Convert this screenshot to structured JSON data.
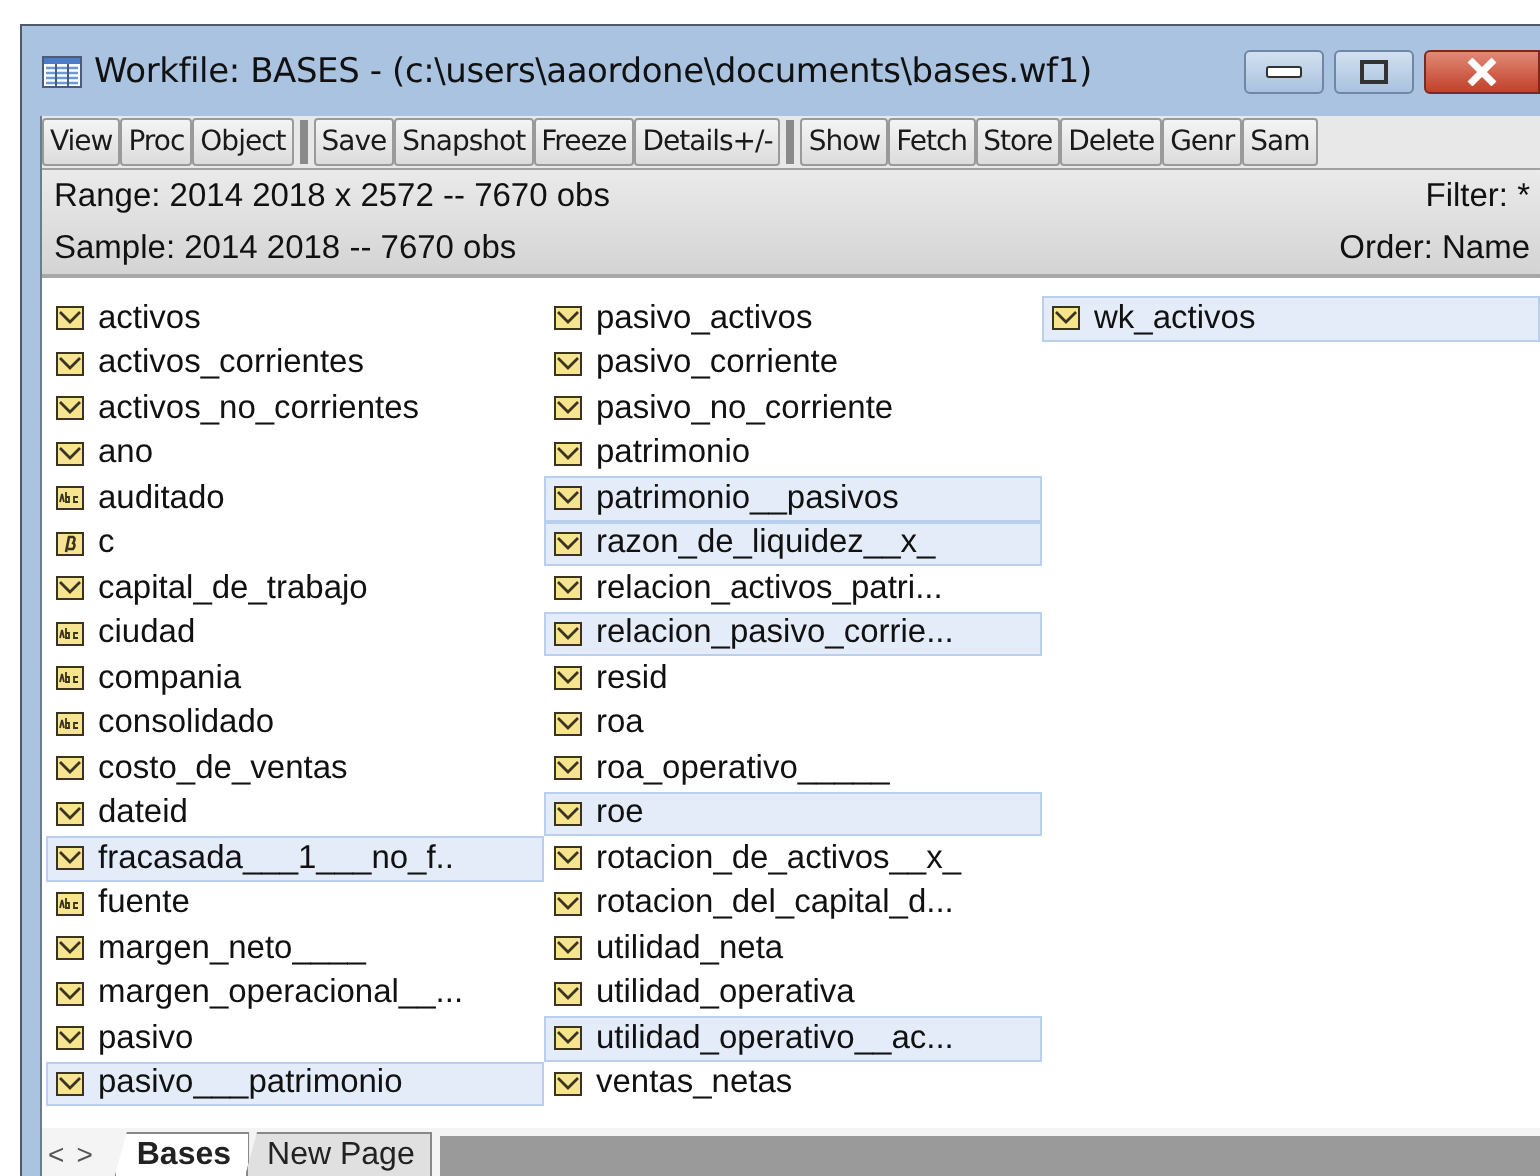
{
  "window": {
    "title": "Workfile: BASES - (c:\\users\\aaordone\\documents\\bases.wf1)"
  },
  "toolbar": [
    {
      "label": "View",
      "group_start": false
    },
    {
      "label": "Proc",
      "group_start": false
    },
    {
      "label": "Object",
      "group_start": false
    },
    {
      "label": "Save",
      "group_start": true
    },
    {
      "label": "Snapshot",
      "group_start": false
    },
    {
      "label": "Freeze",
      "group_start": false
    },
    {
      "label": "Details+/-",
      "group_start": false
    },
    {
      "label": "Show",
      "group_start": true
    },
    {
      "label": "Fetch",
      "group_start": false
    },
    {
      "label": "Store",
      "group_start": false
    },
    {
      "label": "Delete",
      "group_start": false
    },
    {
      "label": "Genr",
      "group_start": false
    },
    {
      "label": "Sam",
      "group_start": false
    }
  ],
  "info": {
    "range": "Range:  2014 2018 x 2572   --   7670 obs",
    "filter": "Filter: *",
    "sample": "Sample: 2014 2018   --   7670 obs",
    "order": "Order: Name"
  },
  "columns": [
    [
      {
        "name": "activos",
        "kind": "series",
        "selected": false
      },
      {
        "name": "activos_corrientes",
        "kind": "series",
        "selected": false
      },
      {
        "name": "activos_no_corrientes",
        "kind": "series",
        "selected": false
      },
      {
        "name": "ano",
        "kind": "series",
        "selected": false
      },
      {
        "name": "auditado",
        "kind": "alpha",
        "selected": false
      },
      {
        "name": "c",
        "kind": "coef",
        "selected": false
      },
      {
        "name": "capital_de_trabajo",
        "kind": "series",
        "selected": false
      },
      {
        "name": "ciudad",
        "kind": "alpha",
        "selected": false
      },
      {
        "name": "compania",
        "kind": "alpha",
        "selected": false
      },
      {
        "name": "consolidado",
        "kind": "alpha",
        "selected": false
      },
      {
        "name": "costo_de_ventas",
        "kind": "series",
        "selected": false
      },
      {
        "name": "dateid",
        "kind": "series",
        "selected": false
      },
      {
        "name": "fracasada___1___no_f..",
        "kind": "series",
        "selected": true
      },
      {
        "name": "fuente",
        "kind": "alpha",
        "selected": false
      },
      {
        "name": "margen_neto____",
        "kind": "series",
        "selected": false
      },
      {
        "name": "margen_operacional__...",
        "kind": "series",
        "selected": false
      },
      {
        "name": "pasivo",
        "kind": "series",
        "selected": false
      },
      {
        "name": "pasivo___patrimonio",
        "kind": "series",
        "selected": true
      }
    ],
    [
      {
        "name": "pasivo_activos",
        "kind": "series",
        "selected": false
      },
      {
        "name": "pasivo_corriente",
        "kind": "series",
        "selected": false
      },
      {
        "name": "pasivo_no_corriente",
        "kind": "series",
        "selected": false
      },
      {
        "name": "patrimonio",
        "kind": "series",
        "selected": false
      },
      {
        "name": "patrimonio__pasivos",
        "kind": "series",
        "selected": true
      },
      {
        "name": "razon_de_liquidez__x_",
        "kind": "series",
        "selected": true
      },
      {
        "name": "relacion_activos_patri...",
        "kind": "series",
        "selected": false
      },
      {
        "name": "relacion_pasivo_corrie...",
        "kind": "series",
        "selected": true
      },
      {
        "name": "resid",
        "kind": "series",
        "selected": false
      },
      {
        "name": "roa",
        "kind": "series",
        "selected": false
      },
      {
        "name": "roa_operativo_____",
        "kind": "series",
        "selected": false
      },
      {
        "name": "roe",
        "kind": "series",
        "selected": true
      },
      {
        "name": "rotacion_de_activos__x_",
        "kind": "series",
        "selected": false
      },
      {
        "name": "rotacion_del_capital_d...",
        "kind": "series",
        "selected": false
      },
      {
        "name": "utilidad_neta",
        "kind": "series",
        "selected": false
      },
      {
        "name": "utilidad_operativa",
        "kind": "series",
        "selected": false
      },
      {
        "name": "utilidad_operativo__ac...",
        "kind": "series",
        "selected": true
      },
      {
        "name": "ventas_netas",
        "kind": "series",
        "selected": false
      }
    ],
    [
      {
        "name": "wk_activos",
        "kind": "series",
        "selected": true
      }
    ]
  ],
  "page_tabs": [
    {
      "label": "Bases",
      "selected": true
    },
    {
      "label": "New Page",
      "selected": false
    }
  ],
  "nav": [
    "<",
    ">"
  ]
}
